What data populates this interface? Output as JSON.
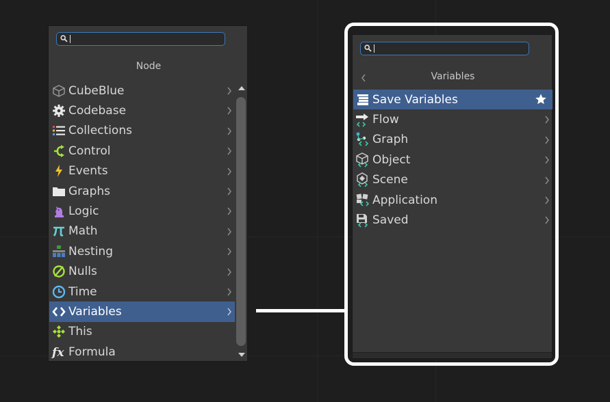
{
  "left_panel": {
    "title": "Node",
    "search": {
      "value": ""
    },
    "items": [
      {
        "label": "CubeBlue",
        "icon": "cube-icon"
      },
      {
        "label": "Codebase",
        "icon": "gear-icon"
      },
      {
        "label": "Collections",
        "icon": "list-icon"
      },
      {
        "label": "Control",
        "icon": "branch-icon"
      },
      {
        "label": "Events",
        "icon": "lightning-icon"
      },
      {
        "label": "Graphs",
        "icon": "folder-icon"
      },
      {
        "label": "Logic",
        "icon": "chess-knight-icon"
      },
      {
        "label": "Math",
        "icon": "pi-icon"
      },
      {
        "label": "Nesting",
        "icon": "nesting-icon"
      },
      {
        "label": "Nulls",
        "icon": "null-icon"
      },
      {
        "label": "Time",
        "icon": "clock-icon"
      },
      {
        "label": "Variables",
        "icon": "code-brackets-icon",
        "selected": true
      },
      {
        "label": "This",
        "icon": "this-icon"
      },
      {
        "label": "Formula",
        "icon": "fx-icon"
      }
    ]
  },
  "right_panel": {
    "title": "Variables",
    "search": {
      "value": ""
    },
    "items": [
      {
        "label": "Save Variables",
        "icon": "save-variables-icon",
        "selected": true,
        "favorite": true
      },
      {
        "label": "Flow",
        "icon": "flow-variable-icon"
      },
      {
        "label": "Graph",
        "icon": "graph-variable-icon"
      },
      {
        "label": "Object",
        "icon": "object-variable-icon"
      },
      {
        "label": "Scene",
        "icon": "scene-variable-icon"
      },
      {
        "label": "Application",
        "icon": "application-variable-icon"
      },
      {
        "label": "Saved",
        "icon": "saved-variable-icon"
      }
    ]
  },
  "colors": {
    "background": "#1e1e1e",
    "panel": "#383838",
    "selected": "#3f5f8f",
    "search_border": "#3a79bb",
    "highlight_frame": "#ffffff"
  }
}
